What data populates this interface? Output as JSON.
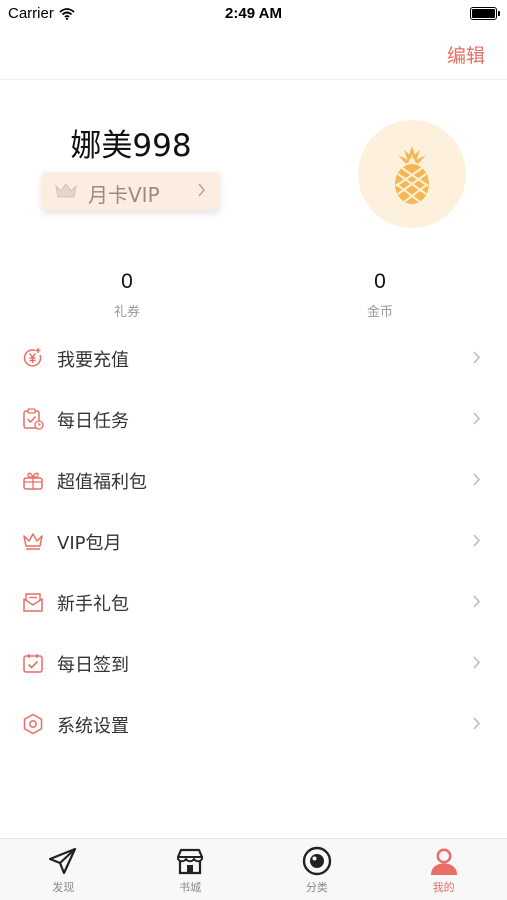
{
  "status_bar": {
    "carrier": "Carrier",
    "time": "2:49 AM"
  },
  "nav": {
    "edit_label": "编辑"
  },
  "profile": {
    "username": "娜美998",
    "vip_label": "月卡VIP",
    "avatar_icon": "pineapple-icon"
  },
  "stats": [
    {
      "value": "0",
      "label": "礼券"
    },
    {
      "value": "0",
      "label": "金币"
    }
  ],
  "menu": {
    "items": [
      {
        "label": "我要充值",
        "icon": "recharge-icon"
      },
      {
        "label": "每日任务",
        "icon": "daily-task-icon"
      },
      {
        "label": "超值福利包",
        "icon": "gift-bag-icon"
      },
      {
        "label": "VIP包月",
        "icon": "crown-icon"
      },
      {
        "label": "新手礼包",
        "icon": "envelope-icon"
      },
      {
        "label": "每日签到",
        "icon": "check-in-icon"
      },
      {
        "label": "系统设置",
        "icon": "settings-icon"
      }
    ]
  },
  "tab_bar": {
    "tabs": [
      {
        "label": "发现",
        "icon": "paper-plane-icon",
        "active": false
      },
      {
        "label": "书城",
        "icon": "bookstore-icon",
        "active": false
      },
      {
        "label": "分类",
        "icon": "category-icon",
        "active": false
      },
      {
        "label": "我的",
        "icon": "user-icon",
        "active": true
      }
    ]
  },
  "colors": {
    "accent": "#e76f65",
    "vip_background": "#fbeee1",
    "avatar_background": "#fdf1dd",
    "pineapple": "#f4b753"
  }
}
